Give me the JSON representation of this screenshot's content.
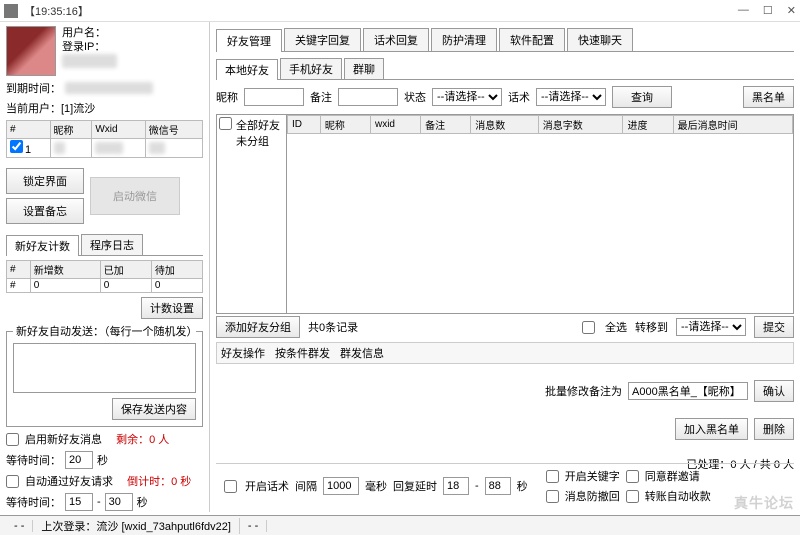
{
  "window": {
    "title_time": "【19:35:16】"
  },
  "left": {
    "user_label": "用户名：",
    "user_value": "",
    "ip_label": "登录IP：",
    "ip_value": "xxxxxxxxxx",
    "expire_label": "到期时间：",
    "expire_value": "xxxxxxxxxxxxxxxx",
    "current_user_label": "当前用户：[1]流沙",
    "acct_table": {
      "cols": [
        "#",
        "昵称",
        "Wxid",
        "微信号"
      ],
      "row": {
        "idx": "1",
        "nick": "xx",
        "wxid": "xxxxx",
        "wxno": "xxx"
      }
    },
    "btn_lock": "锁定界面",
    "btn_backup": "设置备忘",
    "btn_start": "启动微信",
    "tabs_small": {
      "a": "新好友计数",
      "b": "程序日志"
    },
    "friend_table": {
      "cols": [
        "#",
        "新增数",
        "已加",
        "待加"
      ],
      "row": [
        "#",
        "0",
        "0",
        "0"
      ]
    },
    "btn_count_set": "计数设置",
    "auto_send_label": "新好友自动发送：（每行一个随机发）",
    "btn_save_send": "保存发送内容",
    "chk_enable_new": "启用新好友消息",
    "remain_label": "剩余：0 人",
    "wait_label": "等待时间：",
    "wait_val": "20",
    "sec": "秒",
    "chk_auto_pass": "自动通过好友请求",
    "countdown": "倒计时：0 秒",
    "wait2_a": "15",
    "wait2_b": "30"
  },
  "main_tabs": [
    "好友管理",
    "关键字回复",
    "话术回复",
    "防护清理",
    "软件配置",
    "快速聊天"
  ],
  "sub_tabs": [
    "本地好友",
    "手机好友",
    "群聊"
  ],
  "filter": {
    "nick_label": "昵称",
    "remark_label": "备注",
    "status_label": "状态",
    "status_opt": "--请选择--",
    "script_label": "话术",
    "script_opt": "--请选择--",
    "btn_query": "查询",
    "btn_blacklist": "黑名单"
  },
  "tree": {
    "all": "全部好友",
    "ungrouped": "未分组"
  },
  "grid_cols": [
    "ID",
    "昵称",
    "wxid",
    "备注",
    "消息数",
    "消息字数",
    "进度",
    "最后消息时间"
  ],
  "below": {
    "btn_add_group": "添加好友分组",
    "records": "共0条记录",
    "chk_all": "全选",
    "transfer_label": "转移到",
    "transfer_opt": "--请选择--",
    "btn_submit": "提交"
  },
  "ops": {
    "label": "好友操作",
    "a": "按条件群发",
    "b": "群发信息"
  },
  "batch": {
    "label": "批量修改备注为",
    "val": "A000黑名单_【昵称】",
    "btn_confirm": "确认",
    "btn_add_black": "加入黑名单",
    "btn_delete": "删除",
    "processed": "已处理：0 人 / 共 0 人"
  },
  "bottom": {
    "chk_script": "开启话术",
    "interval_label": "间隔",
    "interval_val": "1000",
    "interval_unit": "毫秒",
    "delay_label": "回复延时",
    "delay_a": "18",
    "delay_b": "88",
    "sec": "秒",
    "chk_keyword": "开启关键字",
    "chk_agree_group": "同意群邀请",
    "chk_anti_recall": "消息防撤回",
    "chk_auto_collect": "转账自动收款"
  },
  "status": {
    "seg1": "- -",
    "seg2": "上次登录：流沙 [wxid_73ahputl6fdv22]",
    "seg3": "- -"
  },
  "watermark": "真牛论坛"
}
